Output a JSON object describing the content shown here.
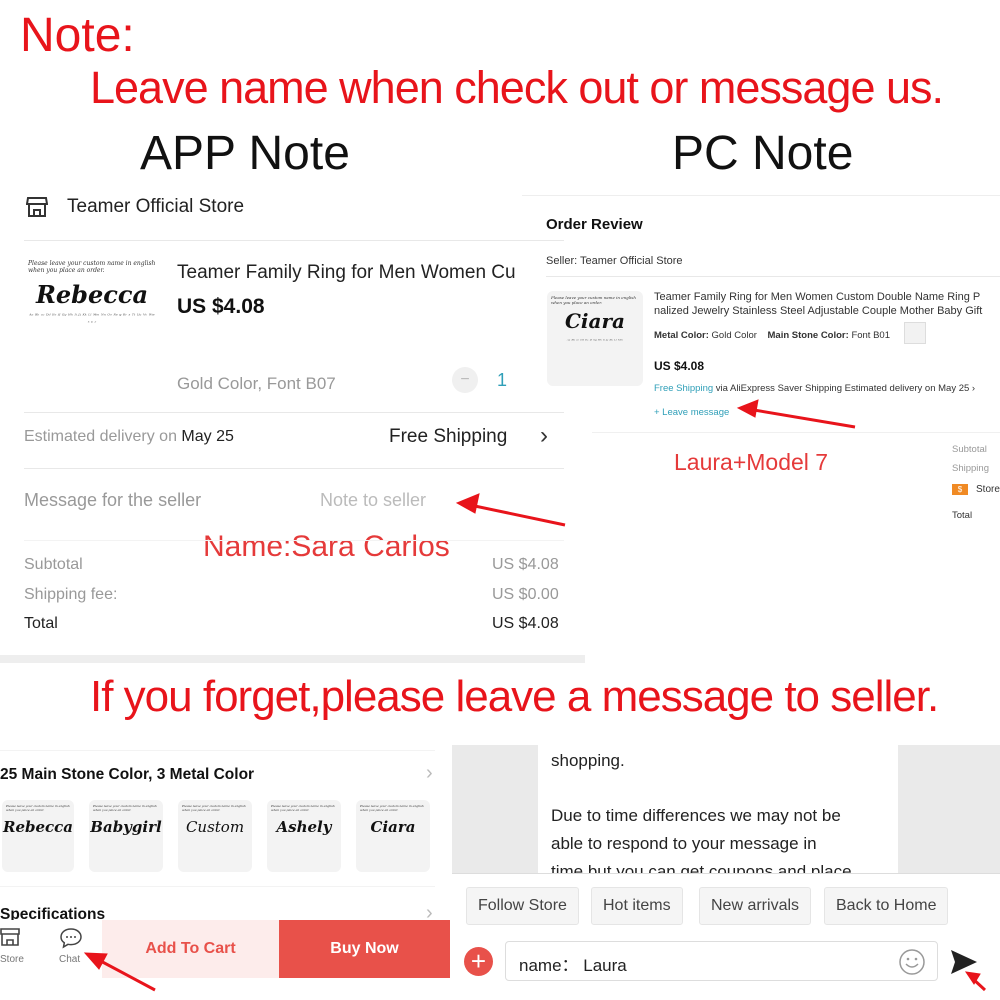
{
  "header": {
    "note": "Note:",
    "instruction": "Leave name when check out or message us.",
    "app_note_title": "APP Note",
    "pc_note_title": "PC Note",
    "forget_instruction": "If you forget,please leave a message to seller."
  },
  "app_order": {
    "store_name": "Teamer Official Store",
    "product_title": "Teamer Family Ring for Men Women Cu",
    "price": "US $4.08",
    "variant": "Gold Color, Font B07",
    "quantity": "1",
    "thumb_caption": "Please leave your custom name in english when you place an order.",
    "thumb_name": "Rebecca",
    "delivery_label": "Estimated delivery on",
    "delivery_date": "May 25",
    "shipping": "Free Shipping",
    "message_label": "Message for the seller",
    "message_placeholder": "Note to seller",
    "annotation": "Name:Sara Carlos",
    "subtotal_label": "Subtotal",
    "subtotal_value": "US $4.08",
    "shipping_fee_label": "Shipping fee:",
    "shipping_fee_value": "US $0.00",
    "total_label": "Total",
    "total_value": "US $4.08"
  },
  "pc_order": {
    "title": "Order Review",
    "seller": "Seller: Teamer Official Store",
    "product_title_1": "Teamer Family Ring for Men Women Custom Double Name Ring P",
    "product_title_2": "nalized Jewelry Stainless Steel Adjustable Couple Mother Baby Gift",
    "metal_label": "Metal Color:",
    "metal_value": "Gold Color",
    "stone_label": "Main Stone Color:",
    "stone_value": "Font B01",
    "price": "US $4.08",
    "free_shipping": "Free Shipping",
    "shipping_via": "via AliExpress Saver Shipping",
    "delivery": "Estimated delivery on May 25",
    "thumb_name": "Ciara",
    "leave_message": "+ Leave message",
    "annotation": "Laura+Model 7",
    "summary_subtotal": "Subtotal",
    "summary_shipping": "Shipping",
    "summary_store_badge": "$",
    "summary_store": "Store",
    "summary_total": "Total"
  },
  "product_page": {
    "options_title": "25 Main Stone Color, 3 Metal Color",
    "options": [
      "Rebecca",
      "Babygirl",
      "Custom",
      "Ashely",
      "Ciara"
    ],
    "specifications": "Specifications",
    "store_label": "Store",
    "chat_label": "Chat",
    "add_to_cart": "Add To Cart",
    "buy_now": "Buy Now"
  },
  "chat": {
    "message_line_0": "shopping.",
    "message_line_1": "Due to time differences we may not be",
    "message_line_2": "able to respond to your message in",
    "message_line_3": "time but you can get coupons and place",
    "quick_replies": [
      "Follow Store",
      "Hot items",
      "New arrivals",
      "Back to Home"
    ],
    "input_value": "name： Laura"
  },
  "colors": {
    "annotation_red": "#e8141b",
    "buy_now": "#e8514a",
    "add_to_cart_bg": "#fdeceb",
    "link_blue": "#2f9fb8"
  }
}
